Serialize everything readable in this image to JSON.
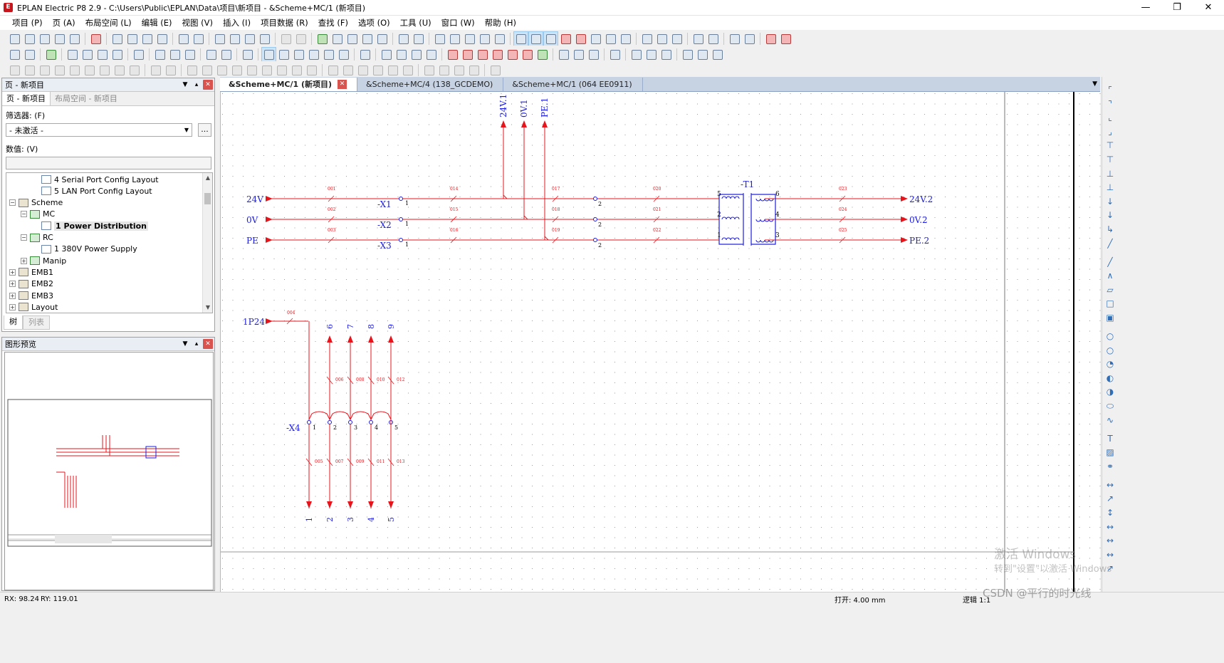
{
  "window": {
    "title": "EPLAN Electric P8 2.9 - C:\\Users\\Public\\EPLAN\\Data\\项目\\新项目 - &Scheme+MC/1 (新项目)",
    "app_icon": "E",
    "controls": [
      "minimize-icon",
      "restore-icon",
      "close-icon"
    ]
  },
  "menu": [
    "项目 (P)",
    "页 (A)",
    "布局空间 (L)",
    "编辑 (E)",
    "视图 (V)",
    "插入 (I)",
    "项目数据 (R)",
    "查找 (F)",
    "选项 (O)",
    "工具 (U)",
    "窗口 (W)",
    "帮助 (H)"
  ],
  "page_panel": {
    "title": "页 - 新项目",
    "tabs": [
      "页 - 新项目",
      "布局空间 - 新项目"
    ],
    "filter_label": "筛选器: (F)",
    "filter_value": "- 未激活 -",
    "filter_button": "...",
    "value_label": "数值: (V)",
    "tree": [
      {
        "label": "4 Serial Port Config Layout",
        "level": 3,
        "icon": "page",
        "expander": ""
      },
      {
        "label": "5 LAN Port Config Layout",
        "level": 3,
        "icon": "page",
        "expander": ""
      },
      {
        "label": "Scheme",
        "level": 1,
        "icon": "folder",
        "expander": "−"
      },
      {
        "label": "MC",
        "level": 2,
        "icon": "struct",
        "expander": "−"
      },
      {
        "label": "1 Power Distribution",
        "level": 3,
        "icon": "page",
        "expander": "",
        "selected": true
      },
      {
        "label": "RC",
        "level": 2,
        "icon": "struct",
        "expander": "−"
      },
      {
        "label": "1 380V Power Supply",
        "level": 3,
        "icon": "page",
        "expander": ""
      },
      {
        "label": "Manip",
        "level": 2,
        "icon": "struct",
        "expander": "+"
      },
      {
        "label": "EMB1",
        "level": 1,
        "icon": "folder",
        "expander": "+"
      },
      {
        "label": "EMB2",
        "level": 1,
        "icon": "folder",
        "expander": "+"
      },
      {
        "label": "EMB3",
        "level": 1,
        "icon": "folder",
        "expander": "+"
      },
      {
        "label": "Layout",
        "level": 1,
        "icon": "folder",
        "expander": "+"
      }
    ],
    "bottom_tabs": [
      "树",
      "列表"
    ]
  },
  "preview_panel": {
    "title": "图形预览"
  },
  "doc_tabs": [
    {
      "label": "&Scheme+MC/1 (新项目)",
      "active": true
    },
    {
      "label": "&Scheme+MC/4 (138_GCDEMO)",
      "active": false
    },
    {
      "label": "&Scheme+MC/1 (064 EE0911)",
      "active": false
    }
  ],
  "schematic": {
    "colors": {
      "wire": "#e8141b",
      "label": "#1d1de0",
      "grid": "#9a9a9a"
    },
    "top_outputs": [
      "24V.1",
      "0V.1",
      "PE.1"
    ],
    "inputs": [
      "24V",
      "0V",
      "PE"
    ],
    "terminal_strips": [
      "-X1",
      "-X2",
      "-X3"
    ],
    "terminal_left_num": "1",
    "terminal_right_num": "2",
    "transformer": {
      "name": "-T1",
      "pins_left": [
        "5",
        "2",
        "1"
      ],
      "pins_right": [
        "6",
        "4",
        "3"
      ]
    },
    "outputs": [
      "24V.2",
      "0V.2",
      "PE.2"
    ],
    "row_wire_ids": [
      [
        "001",
        "014",
        "017",
        "020",
        "023"
      ],
      [
        "002",
        "015",
        "018",
        "021",
        "024"
      ],
      [
        "003",
        "016",
        "019",
        "022",
        "025"
      ]
    ],
    "lower": {
      "input": "1P24",
      "input_wire": "004",
      "strip": "-X4",
      "top_arrows": [
        "6",
        "7",
        "8",
        "9"
      ],
      "terminals": [
        "1",
        "2",
        "3",
        "4",
        "5"
      ],
      "bottom_arrows": [
        "1",
        "2",
        "3",
        "4",
        "5"
      ],
      "upper_wire_ids": [
        "006",
        "008",
        "010",
        "012"
      ],
      "lower_wire_ids": [
        "005",
        "007",
        "009",
        "011",
        "013"
      ]
    }
  },
  "status": {
    "rx": "RX: 98.24",
    "ry": "RY: 119.01",
    "grid": "打开: 4.00 mm",
    "logic": "逻辑 1:1"
  },
  "overlay": {
    "activate_title": "激活 Windows",
    "activate_sub": "转到\"设置\"以激活 Windows",
    "csdn": "CSDN @平行的时光线"
  }
}
